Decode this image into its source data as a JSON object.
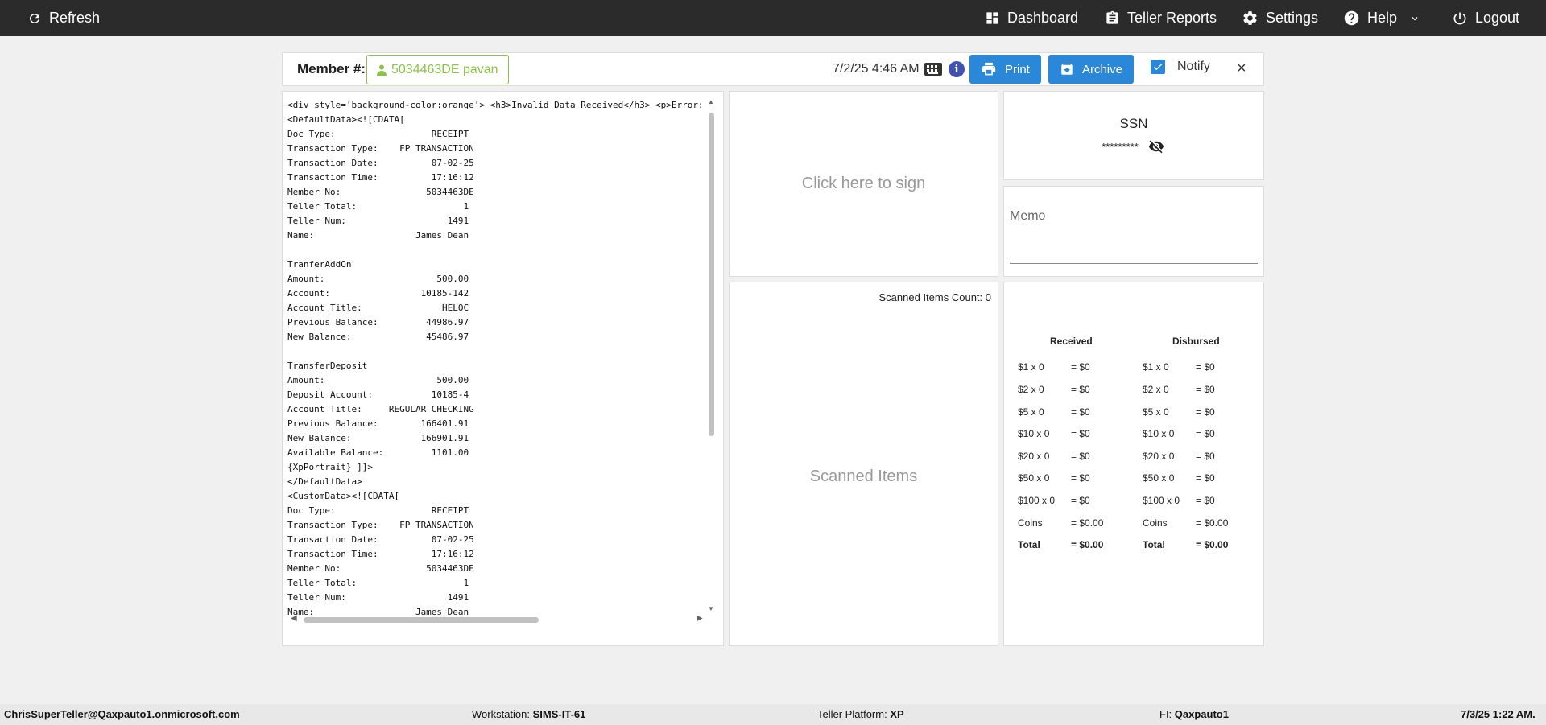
{
  "nav": {
    "refresh": "Refresh",
    "dashboard": "Dashboard",
    "teller_reports": "Teller Reports",
    "settings": "Settings",
    "help": "Help",
    "logout": "Logout"
  },
  "member": {
    "label": "Member #:",
    "value": "5034463DE pavan",
    "datetime": "7/2/25 4:46 AM",
    "info": "i",
    "print_label": "Print",
    "archive_label": "Archive",
    "notify_label": "Notify",
    "close": "×"
  },
  "receipt": {
    "lines": [
      "<div style='background-color:orange'> <h3>Invalid Data Received</h3> <p>Error:",
      "<DefaultData><![CDATA[",
      "Doc Type:                  RECEIPT",
      "Transaction Type:    FP TRANSACTION",
      "Transaction Date:          07-02-25",
      "Transaction Time:          17:16:12",
      "Member No:                5034463DE",
      "Teller Total:                    1",
      "Teller Num:                   1491",
      "Name:                   James Dean",
      "",
      "TranferAddOn",
      "Amount:                     500.00",
      "Account:                 10185-142",
      "Account Title:               HELOC",
      "Previous Balance:         44986.97",
      "New Balance:              45486.97",
      "",
      "TransferDeposit",
      "Amount:                     500.00",
      "Deposit Account:           10185-4",
      "Account Title:     REGULAR CHECKING",
      "Previous Balance:        166401.91",
      "New Balance:             166901.91",
      "Available Balance:         1101.00",
      "{XpPortrait} ]]>",
      "</DefaultData>",
      "<CustomData><![CDATA[",
      "Doc Type:                  RECEIPT",
      "Transaction Type:    FP TRANSACTION",
      "Transaction Date:          07-02-25",
      "Transaction Time:          17:16:12",
      "Member No:                5034463DE",
      "Teller Total:                    1",
      "Teller Num:                   1491",
      "Name:                   James Dean"
    ]
  },
  "sign": {
    "text": "Click here to sign"
  },
  "scanned": {
    "count_label": "Scanned Items Count: 0",
    "placeholder": "Scanned Items"
  },
  "ssn": {
    "title": "SSN",
    "masked": "*********"
  },
  "memo": {
    "label": "Memo"
  },
  "cash": {
    "received_header": "Received",
    "disbursed_header": "Disbursed",
    "received": [
      {
        "label": "$1 x 0",
        "value": "= $0"
      },
      {
        "label": "$2 x 0",
        "value": "= $0"
      },
      {
        "label": "$5 x 0",
        "value": "= $0"
      },
      {
        "label": "$10 x 0",
        "value": "= $0"
      },
      {
        "label": "$20 x 0",
        "value": "= $0"
      },
      {
        "label": "$50 x 0",
        "value": "= $0"
      },
      {
        "label": "$100 x 0",
        "value": "= $0"
      },
      {
        "label": "Coins",
        "value": "= $0.00"
      },
      {
        "label": "Total",
        "value": "= $0.00"
      }
    ],
    "disbursed": [
      {
        "label": "$1 x 0",
        "value": "= $0"
      },
      {
        "label": "$2 x 0",
        "value": "= $0"
      },
      {
        "label": "$5 x 0",
        "value": "= $0"
      },
      {
        "label": "$10 x 0",
        "value": "= $0"
      },
      {
        "label": "$20 x 0",
        "value": "= $0"
      },
      {
        "label": "$50 x 0",
        "value": "= $0"
      },
      {
        "label": "$100 x 0",
        "value": "= $0"
      },
      {
        "label": "Coins",
        "value": "= $0.00"
      },
      {
        "label": "Total",
        "value": "= $0.00"
      }
    ]
  },
  "footer": {
    "user": "ChrisSuperTeller@Qaxpauto1.onmicrosoft.com",
    "workstation_label": "Workstation:",
    "workstation": "SIMS-IT-61",
    "platform_label": "Teller Platform:",
    "platform": "XP",
    "fi_label": "FI:",
    "fi": "Qaxpauto1",
    "datetime": "7/3/25 1:22 AM."
  }
}
